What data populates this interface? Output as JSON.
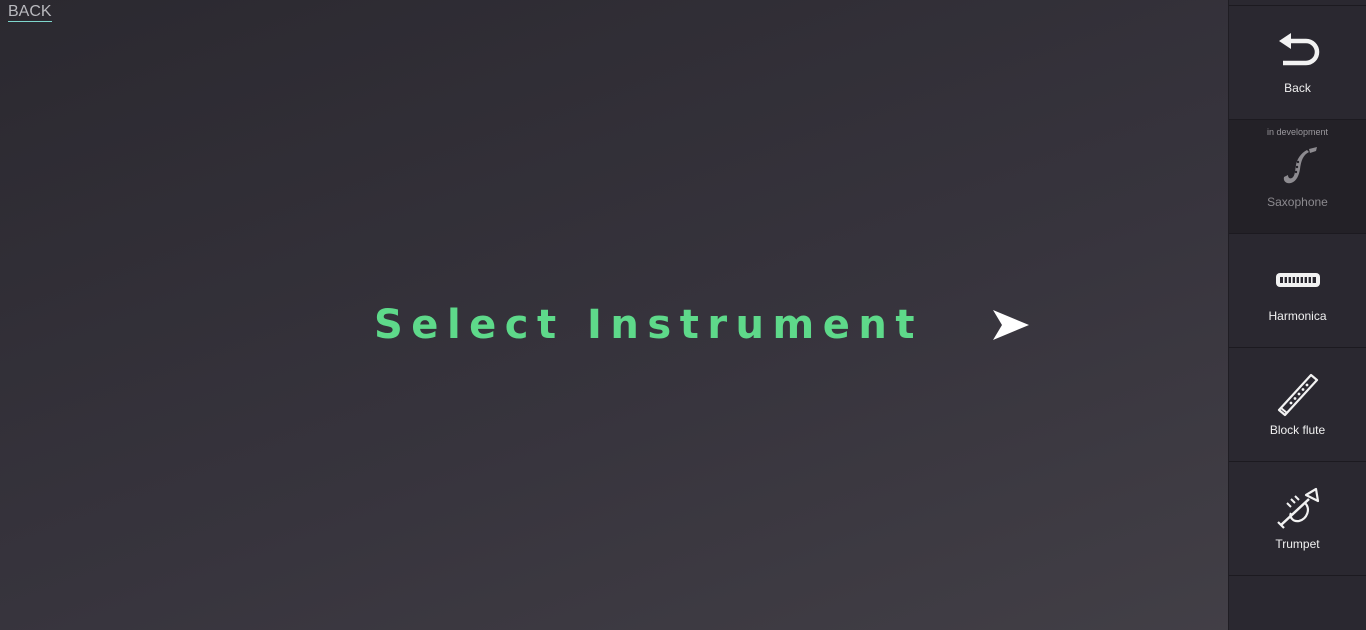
{
  "top_link": {
    "label": "BACK"
  },
  "main": {
    "prompt": "Select Instrument"
  },
  "sidebar": {
    "items": [
      {
        "label": "Back",
        "icon": "undo-arrow-icon"
      },
      {
        "label": "Saxophone",
        "icon": "saxophone-icon",
        "note": "in development"
      },
      {
        "label": "Harmonica",
        "icon": "harmonica-icon"
      },
      {
        "label": "Block flute",
        "icon": "flute-icon"
      },
      {
        "label": "Trumpet",
        "icon": "trumpet-icon"
      }
    ]
  },
  "colors": {
    "prompt": "#5ed98a",
    "sidebar_bg": "#2a2830",
    "link_underline": "#7fd6cd"
  }
}
